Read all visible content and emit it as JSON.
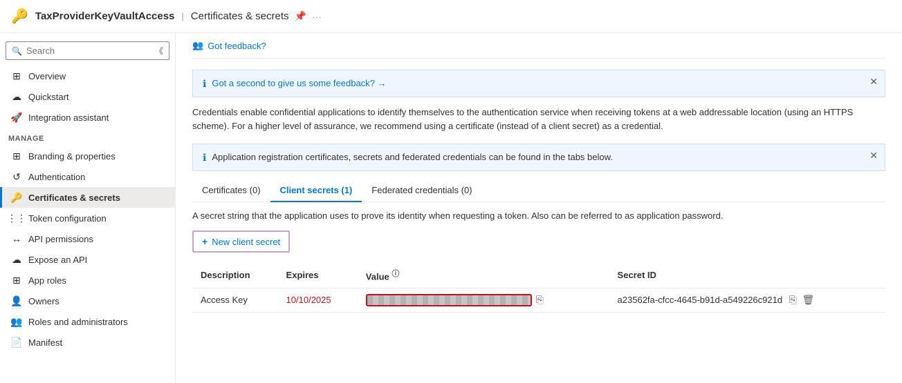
{
  "header": {
    "app_icon": "🔑",
    "app_name": "TaxProviderKeyVaultAccess",
    "separator": "|",
    "page_title": "Certificates & secrets",
    "pin_icon": "📌",
    "more_icon": "···"
  },
  "sidebar": {
    "search_placeholder": "Search",
    "collapse_tooltip": "Collapse",
    "items": [
      {
        "id": "overview",
        "label": "Overview",
        "icon": "⊞"
      },
      {
        "id": "quickstart",
        "label": "Quickstart",
        "icon": "☁"
      },
      {
        "id": "integration-assistant",
        "label": "Integration assistant",
        "icon": "🚀"
      }
    ],
    "manage_label": "Manage",
    "manage_items": [
      {
        "id": "branding",
        "label": "Branding & properties",
        "icon": "⊞"
      },
      {
        "id": "authentication",
        "label": "Authentication",
        "icon": "↺"
      },
      {
        "id": "certificates",
        "label": "Certificates & secrets",
        "icon": "🔑",
        "active": true
      },
      {
        "id": "token",
        "label": "Token configuration",
        "icon": "⋮⋮⋮"
      },
      {
        "id": "api-permissions",
        "label": "API permissions",
        "icon": "↔"
      },
      {
        "id": "expose-api",
        "label": "Expose an API",
        "icon": "☁"
      },
      {
        "id": "app-roles",
        "label": "App roles",
        "icon": "⊞"
      },
      {
        "id": "owners",
        "label": "Owners",
        "icon": "👤"
      },
      {
        "id": "roles-admins",
        "label": "Roles and administrators",
        "icon": "👥"
      },
      {
        "id": "manifest",
        "label": "Manifest",
        "icon": "📄"
      }
    ]
  },
  "content": {
    "feedback": {
      "icon": "👥",
      "text": "Got feedback?"
    },
    "banner1": {
      "text": "Got a second to give us some feedback? →"
    },
    "description": "Credentials enable confidential applications to identify themselves to the authentication service when receiving tokens at a web addressable location (using an HTTPS scheme). For a higher level of assurance, we recommend using a certificate (instead of a client secret) as a credential.",
    "banner2": {
      "text": "Application registration certificates, secrets and federated credentials can be found in the tabs below."
    },
    "tabs": [
      {
        "id": "certificates",
        "label": "Certificates (0)",
        "active": false
      },
      {
        "id": "client-secrets",
        "label": "Client secrets (1)",
        "active": true
      },
      {
        "id": "federated",
        "label": "Federated credentials (0)",
        "active": false
      }
    ],
    "tab_description": "A secret string that the application uses to prove its identity when requesting a token. Also can be referred to as application password.",
    "new_secret_button": "+ New client secret",
    "table": {
      "headers": [
        "Description",
        "Expires",
        "Value",
        "Secret ID"
      ],
      "value_info": "ⓘ",
      "rows": [
        {
          "description": "Access Key",
          "expires": "10/10/2025",
          "value": "BLURRED",
          "secret_id": "a23562fa-cfcc-4645-b91d-a549226c921d"
        }
      ]
    }
  }
}
